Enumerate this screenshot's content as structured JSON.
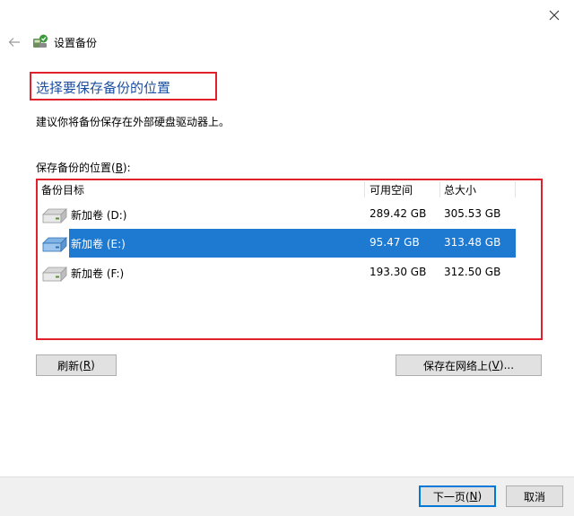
{
  "window": {
    "title": "设置备份"
  },
  "page": {
    "heading": "选择要保存备份的位置",
    "subtitle": "建议你将备份保存在外部硬盘驱动器上。",
    "location_label_prefix": "保存备份的位置(",
    "location_label_key": "B",
    "location_label_suffix": "):"
  },
  "table": {
    "columns": [
      "备份目标",
      "可用空间",
      "总大小"
    ],
    "rows": [
      {
        "name": "新加卷 (D:)",
        "free": "289.42 GB",
        "total": "305.53 GB",
        "selected": false
      },
      {
        "name": "新加卷 (E:)",
        "free": "95.47 GB",
        "total": "313.48 GB",
        "selected": true
      },
      {
        "name": "新加卷 (F:)",
        "free": "193.30 GB",
        "total": "312.50 GB",
        "selected": false
      }
    ]
  },
  "buttons": {
    "refresh_prefix": "刷新(",
    "refresh_key": "R",
    "refresh_suffix": ")",
    "network_prefix": "保存在网络上(",
    "network_key": "V",
    "network_suffix": ")...",
    "next_prefix": "下一页(",
    "next_key": "N",
    "next_suffix": ")",
    "cancel": "取消"
  },
  "colors": {
    "heading": "#1c4fa0",
    "selection": "#1e79d1",
    "highlight_border": "#e0202a"
  }
}
